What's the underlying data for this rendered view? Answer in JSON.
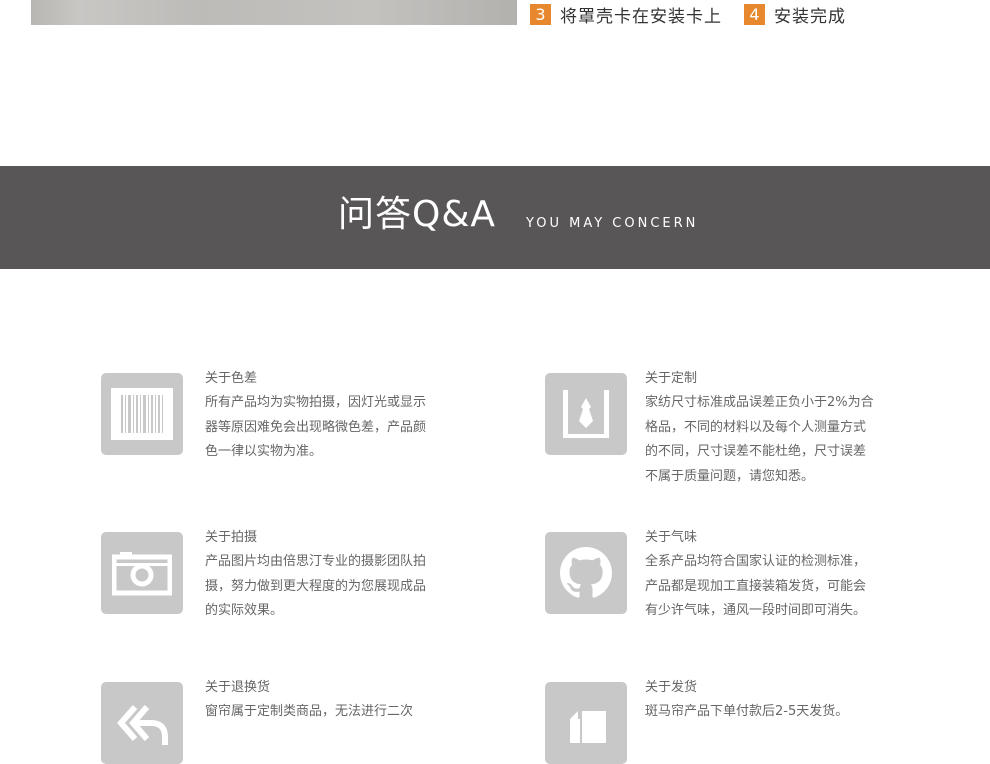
{
  "steps": [
    {
      "num": "3",
      "text": "将罩壳卡在安装卡上"
    },
    {
      "num": "4",
      "text": "安装完成"
    }
  ],
  "section": {
    "title": "问答Q&A",
    "subtitle": "YOU MAY CONCERN"
  },
  "faq": [
    {
      "icon": "barcode-icon",
      "title": "关于色差",
      "body": "所有产品均为实物拍摄，因灯光或显示器等原因难免会出现略微色差，产品颜色一律以实物为准。"
    },
    {
      "icon": "tie-icon",
      "title": "关于定制",
      "body": "家纺尺寸标准成品误差正负小于2%为合格品，不同的材料以及每个人测量方式的不同，尺寸误差不能杜绝，尺寸误差不属于质量问题，请您知悉。"
    },
    {
      "icon": "camera-icon",
      "title": "关于拍摄",
      "body": "产品图片均由倍思汀专业的摄影团队拍摄，努力做到更大程度的为您展现成品的实际效果。"
    },
    {
      "icon": "github-icon",
      "title": "关于气味",
      "body": "全系产品均符合国家认证的检测标准，产品都是现加工直接装箱发货，可能会有少许气味，通风一段时间即可消失。"
    },
    {
      "icon": "return-icon",
      "title": "关于退换货",
      "body": "窗帘属于定制类商品，无法进行二次"
    },
    {
      "icon": "shipping-icon",
      "title": "关于发货",
      "body": "斑马帘产品下单付款后2-5天发货。"
    }
  ],
  "colors": {
    "accent": "#e8882e",
    "band": "#585656",
    "icon_bg": "#c8c8c8"
  }
}
